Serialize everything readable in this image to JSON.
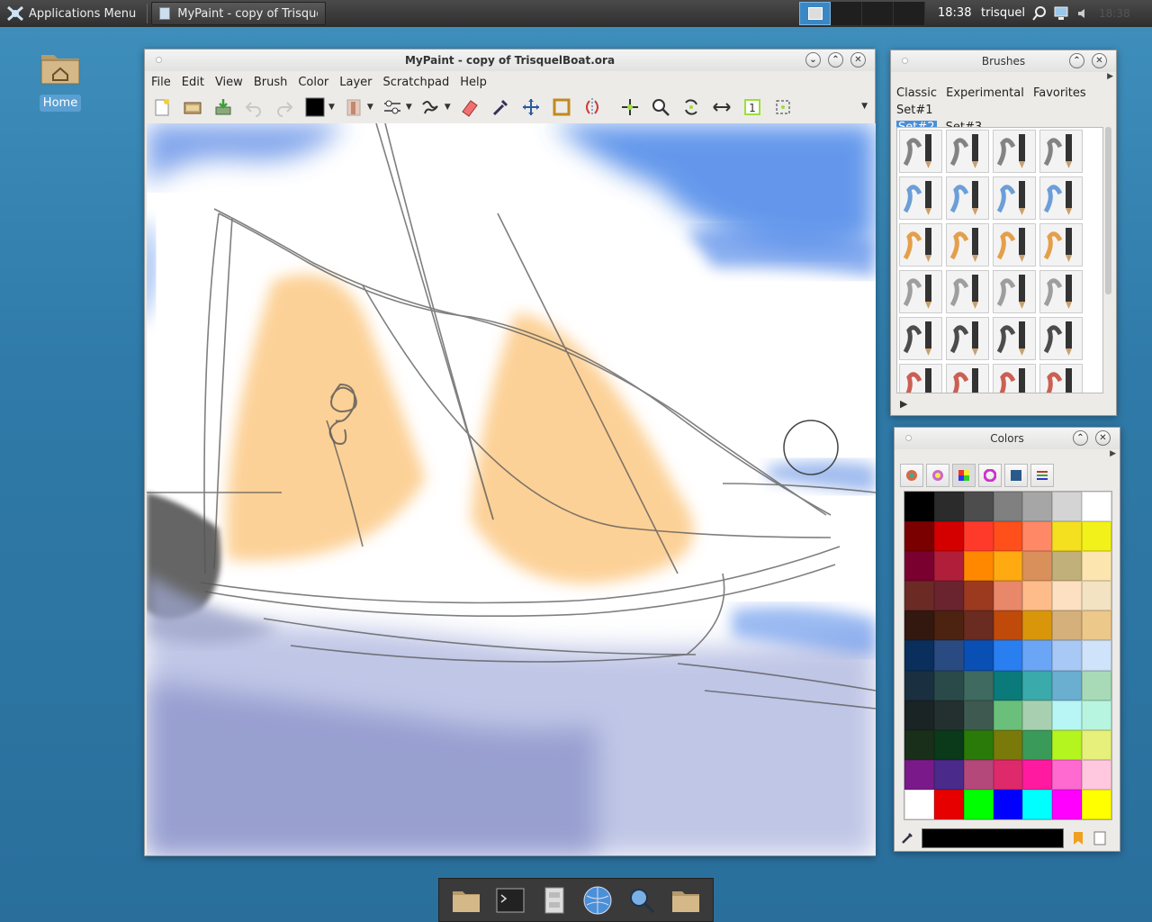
{
  "top_panel": {
    "apps_menu_label": "Applications Menu",
    "task_label": "MyPaint - copy of TrisquelB...",
    "clock": "18:38",
    "user": "trisquel",
    "clock_dim": "18:38"
  },
  "desktop": {
    "home_label": "Home"
  },
  "main_window": {
    "title": "MyPaint - copy of TrisquelBoat.ora",
    "menu": [
      "File",
      "Edit",
      "View",
      "Brush",
      "Color",
      "Layer",
      "Scratchpad",
      "Help"
    ],
    "toolbar_icons": [
      "new-icon",
      "open-icon",
      "save-icon",
      "undo-icon",
      "redo-icon",
      "color-icon",
      "brush-icon",
      "settings-icon",
      "stroke-icon",
      "eraser-icon",
      "picker-icon",
      "pan-icon",
      "frame-icon",
      "symmetry-icon",
      "move-icon",
      "zoom-icon",
      "rotate-icon",
      "flip-icon",
      "scale-icon",
      "fit-icon"
    ]
  },
  "brushes_window": {
    "title": "Brushes",
    "groups": [
      "Classic",
      "Experimental",
      "Favorites",
      "Set#1",
      "Set#2",
      "Set#3"
    ],
    "selected_group": "Set#2"
  },
  "colors_window": {
    "title": "Colors",
    "palette": [
      "#000000",
      "#2b2b2b",
      "#4d4d4d",
      "#808080",
      "#a6a6a6",
      "#d4d4d4",
      "#ffffff",
      "#7a0000",
      "#d40000",
      "#ff3a2a",
      "#ff4f1a",
      "#ff8866",
      "#f5e020",
      "#f2f21a",
      "#7a0030",
      "#b01e3a",
      "#ff8800",
      "#ffaa11",
      "#d9905a",
      "#c2b07a",
      "#fde5b0",
      "#6b2a24",
      "#6a2430",
      "#9c3a20",
      "#e8876a",
      "#fdbc8a",
      "#fde0c2",
      "#f3e3c2",
      "#331810",
      "#4c2210",
      "#6a2b20",
      "#bf4a0a",
      "#d9960a",
      "#d6b07a",
      "#ecc88a",
      "#0a2f5c",
      "#2a4a82",
      "#0a4fb4",
      "#2a7ff0",
      "#6aa6f5",
      "#a8c8f5",
      "#cfe3fa",
      "#1a3040",
      "#2a4a4a",
      "#3e6a60",
      "#0a7a7a",
      "#3aaaaa",
      "#6aaed0",
      "#a8dab8",
      "#1a2424",
      "#243030",
      "#3e5a50",
      "#6ac07a",
      "#a8d0b0",
      "#b8f5f5",
      "#b8f5e0",
      "#1a2f1a",
      "#0a3a1a",
      "#2a7a0a",
      "#7a7a0a",
      "#3a9a5a",
      "#b4f520",
      "#e6f07a",
      "#7a1a8a",
      "#4a2a8a",
      "#b4487a",
      "#de2a6a",
      "#ff1aa0",
      "#ff6ad0",
      "#ffc8de",
      "#ffffff",
      "#e60000",
      "#00ff00",
      "#0000ff",
      "#00ffff",
      "#ff00ff",
      "#ffff00"
    ],
    "current_color": "#000000"
  }
}
